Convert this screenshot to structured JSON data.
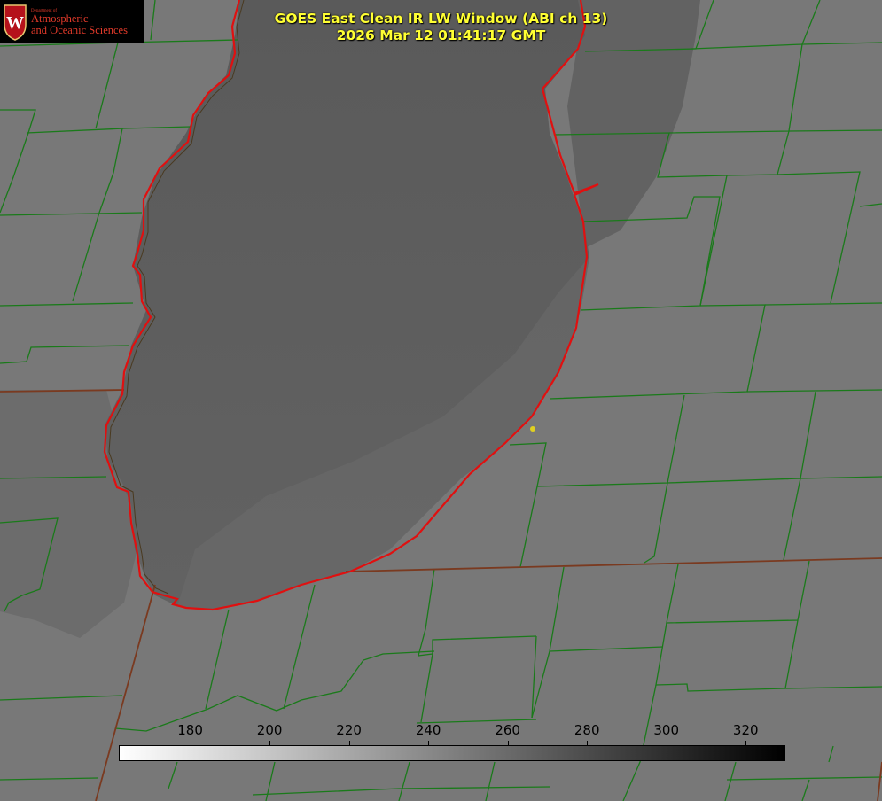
{
  "logo": {
    "department": "Department of",
    "line1": "Atmospheric",
    "line2": "and Oceanic Sciences",
    "emblem": "uw-crest-icon",
    "colors": {
      "background": "#000000",
      "text": "#e23a2a",
      "crest": "#b5121b"
    }
  },
  "title": {
    "line1": "GOES East Clean IR LW Window (ABI ch 13)",
    "line2": "2026 Mar 12 01:41:17 GMT",
    "color": "#ffff33"
  },
  "colorbar": {
    "ticks": [
      {
        "label": "180",
        "value": 180
      },
      {
        "label": "200",
        "value": 200
      },
      {
        "label": "220",
        "value": 220
      },
      {
        "label": "240",
        "value": 240
      },
      {
        "label": "260",
        "value": 260
      },
      {
        "label": "280",
        "value": 280
      },
      {
        "label": "300",
        "value": 300
      },
      {
        "label": "320",
        "value": 320
      }
    ],
    "range": [
      162,
      330
    ],
    "gradient": [
      "#ffffff",
      "#000000"
    ]
  },
  "map": {
    "colors": {
      "land": "#7a7a7a",
      "lake": "#5e5e5e",
      "county_lines": "#1a7a1a",
      "state_and_coast_lines": "#e01010",
      "marker": "#e0d020"
    }
  }
}
